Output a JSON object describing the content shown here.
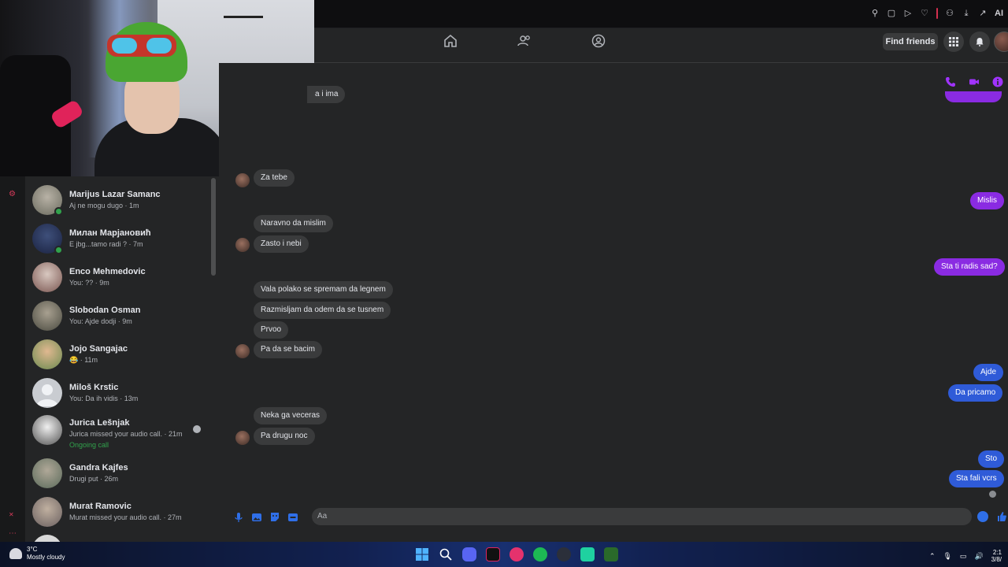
{
  "browser": {
    "ai_label": "AI",
    "icons": [
      "pin-icon",
      "tab-icon",
      "play-icon",
      "heart-icon",
      "account-icon",
      "download-icon",
      "share-icon"
    ]
  },
  "fb_header": {
    "nav": [
      "home-icon",
      "friends-icon",
      "groups-icon"
    ],
    "find_friends": "Find friends",
    "icons": [
      "menu-grid-icon",
      "bell-icon"
    ]
  },
  "conversation": {
    "header_icons": [
      "phone-icon",
      "video-icon",
      "info-icon"
    ],
    "partial_text": "a i ima",
    "messages": [
      {
        "text": "Za tebe",
        "dir": "in"
      },
      {
        "text": "Mislis",
        "dir": "out"
      },
      {
        "text": "Naravno da mislim",
        "dir": "in"
      },
      {
        "text": "Zasto i nebi",
        "dir": "in"
      },
      {
        "text": "Sta ti radis sad?",
        "dir": "out"
      },
      {
        "text": "Vala polako se spremam da legnem",
        "dir": "in"
      },
      {
        "text": "Razmisljam da odem da se tusnem",
        "dir": "in"
      },
      {
        "text": "Prvoo",
        "dir": "in"
      },
      {
        "text": "Pa da se bacim",
        "dir": "in"
      },
      {
        "text": "Ajde",
        "dir": "out"
      },
      {
        "text": "Da pricamo",
        "dir": "out"
      },
      {
        "text": "Neka ga veceras",
        "dir": "in"
      },
      {
        "text": "Pa drugu noc",
        "dir": "in"
      },
      {
        "text": "Sto",
        "dir": "out"
      },
      {
        "text": "Sta fali vcrs",
        "dir": "out"
      }
    ],
    "composer_placeholder": "Aa",
    "composer_icons": [
      "microphone-icon",
      "image-icon",
      "sticker-icon",
      "gif-icon"
    ]
  },
  "chats": [
    {
      "name": "Marijus Lazar Samanc",
      "preview": "Aj ne mogu dugo · 1m",
      "online": true
    },
    {
      "name": "Милан Марјановић",
      "preview": "E jbg...tamo radi ? · 7m",
      "online": true
    },
    {
      "name": "Enco Mehmedovic",
      "preview": "You: ?? · 9m",
      "online": false
    },
    {
      "name": "Slobodan Osman",
      "preview": "You: Ajde dodji · 9m",
      "online": false
    },
    {
      "name": "Jojo Sangajac",
      "preview": "😂 · 11m",
      "online": false
    },
    {
      "name": "Miloš Krstic",
      "preview": "You: Da ih vidis · 13m",
      "online": false
    },
    {
      "name": "Jurica Lešnjak",
      "preview": "Jurica missed your audio call. · 21m",
      "extra": "Ongoing call",
      "online": false
    },
    {
      "name": "Gandra Kajfes",
      "preview": "Drugi put · 26m",
      "online": false
    },
    {
      "name": "Murat Ramovic",
      "preview": "Murat missed your audio call. · 27m",
      "online": false
    }
  ],
  "taskbar": {
    "temperature": "3°C",
    "weather": "Mostly cloudy",
    "time": "2:1",
    "date": "3/8/"
  }
}
